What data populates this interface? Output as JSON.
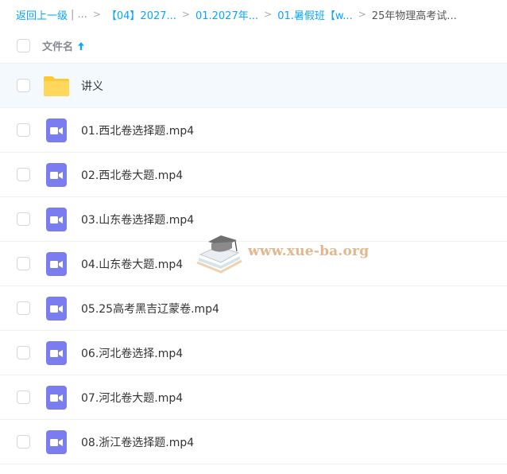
{
  "breadcrumb": {
    "back": "返回上一级",
    "divider": "|",
    "ellipsis": "...",
    "sep": ">",
    "items": [
      "【04】2027...",
      "01.2027年...",
      "01.暑假班【w..."
    ],
    "current": "25年物理高考试..."
  },
  "header": {
    "label": "文件名"
  },
  "files": [
    {
      "name": "讲义",
      "type": "folder"
    },
    {
      "name": "01.西北卷选择题.mp4",
      "type": "video"
    },
    {
      "name": "02.西北卷大题.mp4",
      "type": "video"
    },
    {
      "name": "03.山东卷选择题.mp4",
      "type": "video"
    },
    {
      "name": "04.山东卷大题.mp4",
      "type": "video"
    },
    {
      "name": "05.25高考黑吉辽蒙卷.mp4",
      "type": "video"
    },
    {
      "name": "06.河北卷选择.mp4",
      "type": "video"
    },
    {
      "name": "07.河北卷大题.mp4",
      "type": "video"
    },
    {
      "name": "08.浙江卷选择题.mp4",
      "type": "video"
    }
  ],
  "watermark": {
    "text": "www.xue-ba.org"
  },
  "colors": {
    "link": "#06a7ff",
    "folder": "#ffd04b",
    "video": "#7b7cf0",
    "selected_row": "#f4f9fe"
  }
}
